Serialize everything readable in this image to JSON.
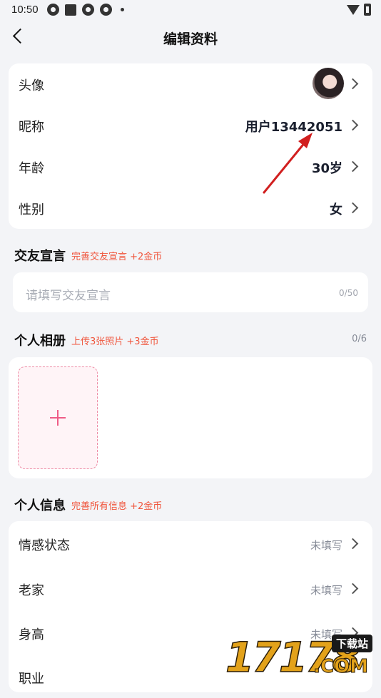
{
  "status_bar": {
    "time": "10:50"
  },
  "header": {
    "title": "编辑资料"
  },
  "profile": {
    "avatar_label": "头像",
    "nickname_label": "昵称",
    "nickname_value": "用户13442051",
    "age_label": "年龄",
    "age_value": "30岁",
    "gender_label": "性别",
    "gender_value": "女"
  },
  "declaration": {
    "title": "交友宣言",
    "hint": "完善交友宣言 +2金币",
    "placeholder": "请填写交友宣言",
    "counter": "0/50"
  },
  "album": {
    "title": "个人相册",
    "hint": "上传3张照片 +3金币",
    "counter": "0/6"
  },
  "info": {
    "title": "个人信息",
    "hint": "完善所有信息 +2金币",
    "items": [
      {
        "label": "情感状态",
        "value": "未填写"
      },
      {
        "label": "老家",
        "value": "未填写"
      },
      {
        "label": "身高",
        "value": "未填写"
      },
      {
        "label": "职业"
      }
    ]
  },
  "watermark": {
    "number": "17178",
    "tag": "下载站",
    "domain": ".COM"
  },
  "colors": {
    "accent": "#f0553c",
    "pink": "#ef5b86",
    "background": "#f3f4f7"
  }
}
